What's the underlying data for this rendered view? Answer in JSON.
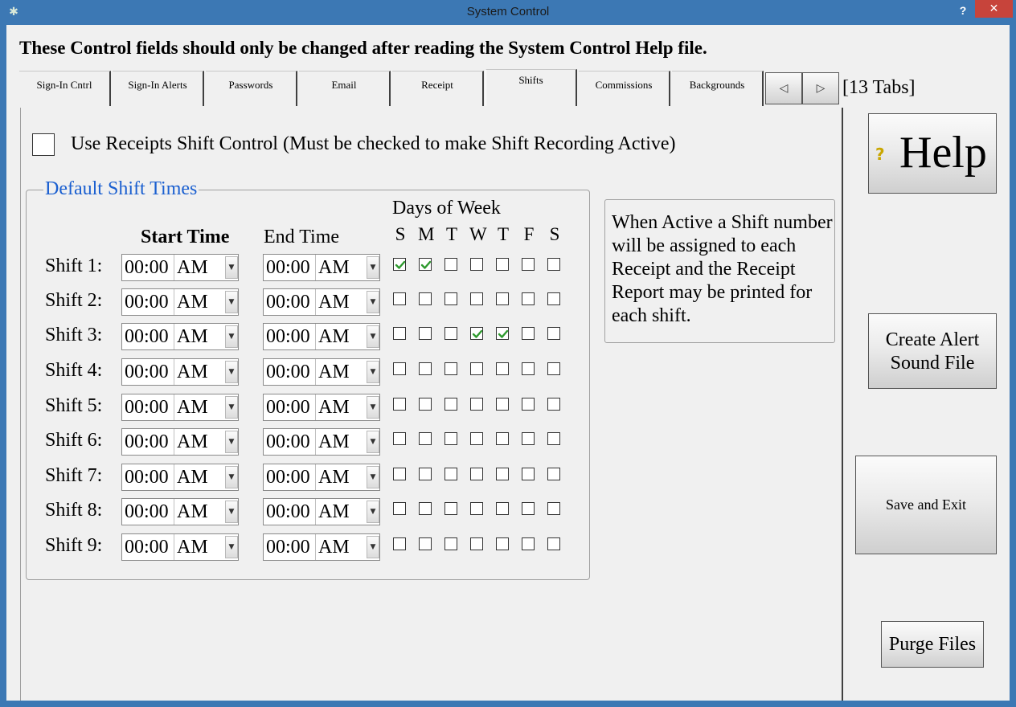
{
  "window": {
    "title": "System Control",
    "help_glyph": "?",
    "close_glyph": "✕",
    "app_icon_glyph": "✱"
  },
  "warning": "These Control fields should only be changed after reading the System Control Help file.",
  "tabs": [
    {
      "label": "Sign-In Cntrl",
      "active": false
    },
    {
      "label": "Sign-In Alerts",
      "active": false
    },
    {
      "label": "Passwords",
      "active": false
    },
    {
      "label": "Email",
      "active": false
    },
    {
      "label": "Receipt",
      "active": false
    },
    {
      "label": "Shifts",
      "active": true
    },
    {
      "label": "Commissions",
      "active": false
    },
    {
      "label": "Backgrounds",
      "active": false
    }
  ],
  "tab_nav": {
    "prev_glyph": "◁",
    "next_glyph": "▷",
    "count_label": "[13 Tabs]"
  },
  "shifts_tab": {
    "use_shift_label": "Use Receipts Shift Control (Must be checked to make Shift Recording Active)",
    "use_shift_checked": false,
    "group_title": "Default Shift Times",
    "start_header": "Start Time",
    "end_header": "End Time",
    "days_header": "Days of Week",
    "day_letters": [
      "S",
      "M",
      "T",
      "W",
      "T",
      "F",
      "S"
    ],
    "dropdown_glyph": "▼",
    "shifts": [
      {
        "label": "Shift 1:",
        "start_time": "00:00",
        "start_ampm": "AM",
        "end_time": "00:00",
        "end_ampm": "AM",
        "days": [
          true,
          true,
          false,
          false,
          false,
          false,
          false
        ]
      },
      {
        "label": "Shift 2:",
        "start_time": "00:00",
        "start_ampm": "AM",
        "end_time": "00:00",
        "end_ampm": "AM",
        "days": [
          false,
          false,
          false,
          false,
          false,
          false,
          false
        ]
      },
      {
        "label": "Shift 3:",
        "start_time": "00:00",
        "start_ampm": "AM",
        "end_time": "00:00",
        "end_ampm": "AM",
        "days": [
          false,
          false,
          false,
          true,
          true,
          false,
          false
        ]
      },
      {
        "label": "Shift 4:",
        "start_time": "00:00",
        "start_ampm": "AM",
        "end_time": "00:00",
        "end_ampm": "AM",
        "days": [
          false,
          false,
          false,
          false,
          false,
          false,
          false
        ]
      },
      {
        "label": "Shift 5:",
        "start_time": "00:00",
        "start_ampm": "AM",
        "end_time": "00:00",
        "end_ampm": "AM",
        "days": [
          false,
          false,
          false,
          false,
          false,
          false,
          false
        ]
      },
      {
        "label": "Shift 6:",
        "start_time": "00:00",
        "start_ampm": "AM",
        "end_time": "00:00",
        "end_ampm": "AM",
        "days": [
          false,
          false,
          false,
          false,
          false,
          false,
          false
        ]
      },
      {
        "label": "Shift 7:",
        "start_time": "00:00",
        "start_ampm": "AM",
        "end_time": "00:00",
        "end_ampm": "AM",
        "days": [
          false,
          false,
          false,
          false,
          false,
          false,
          false
        ]
      },
      {
        "label": "Shift 8:",
        "start_time": "00:00",
        "start_ampm": "AM",
        "end_time": "00:00",
        "end_ampm": "AM",
        "days": [
          false,
          false,
          false,
          false,
          false,
          false,
          false
        ]
      },
      {
        "label": "Shift 9:",
        "start_time": "00:00",
        "start_ampm": "AM",
        "end_time": "00:00",
        "end_ampm": "AM",
        "days": [
          false,
          false,
          false,
          false,
          false,
          false,
          false
        ]
      }
    ],
    "info_text": "When Active a Shift number will be assigned to each Receipt and the Receipt Report  may be printed for each shift."
  },
  "buttons": {
    "help": "Help",
    "help_icon_glyph": "?",
    "create_alert": "Create Alert Sound File",
    "save_exit": "Save and Exit",
    "purge": "Purge Files"
  },
  "colors": {
    "title_bar": "#3c78b4",
    "close_button": "#c7443b",
    "check_tick": "#2e9a2e",
    "group_title": "#1a5fd0"
  }
}
